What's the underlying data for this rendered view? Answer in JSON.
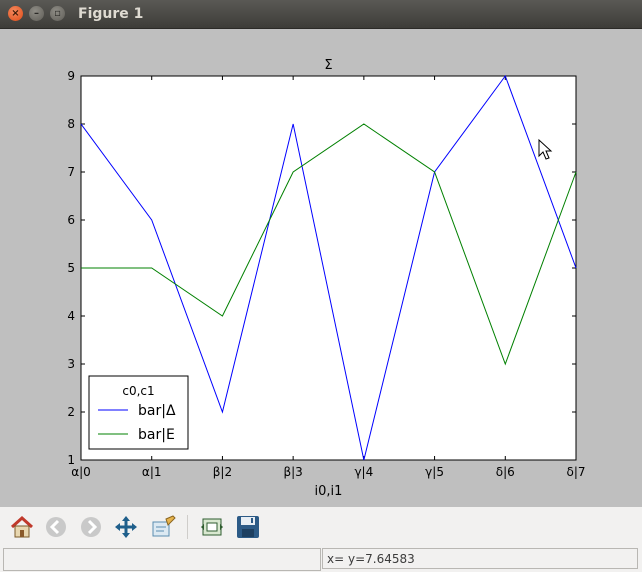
{
  "window": {
    "title": "Figure 1",
    "close_glyph": "×",
    "min_glyph": "–",
    "max_glyph": "▫"
  },
  "toolbar": {
    "items": [
      "home-icon",
      "back-icon",
      "forward-icon",
      "pan-icon",
      "zoom-icon",
      "subplots-icon",
      "save-icon"
    ]
  },
  "status": {
    "left": "",
    "coords": "x= y=7.64583"
  },
  "colors": {
    "series_1": "#0000ff",
    "series_2": "#008000",
    "canvas_bg": "#bfbfbf",
    "axes_bg": "#ffffff"
  },
  "chart_data": {
    "type": "line",
    "title": "Σ",
    "xlabel": "i0,i1",
    "ylabel": "",
    "categories": [
      "α|0",
      "α|1",
      "β|2",
      "β|3",
      "γ|4",
      "γ|5",
      "δ|6",
      "δ|7"
    ],
    "ylim": [
      1,
      9
    ],
    "yticks": [
      1,
      2,
      3,
      4,
      5,
      6,
      7,
      8,
      9
    ],
    "grid": false,
    "legend": {
      "title": "c0,c1",
      "placement": "lower-left"
    },
    "series": [
      {
        "name": "bar|Δ",
        "color": "#0000ff",
        "values": [
          8,
          6,
          2,
          8,
          1,
          7,
          9,
          5
        ]
      },
      {
        "name": "bar|E",
        "color": "#008000",
        "values": [
          5,
          5,
          4,
          7,
          8,
          7,
          3,
          7
        ]
      }
    ]
  }
}
